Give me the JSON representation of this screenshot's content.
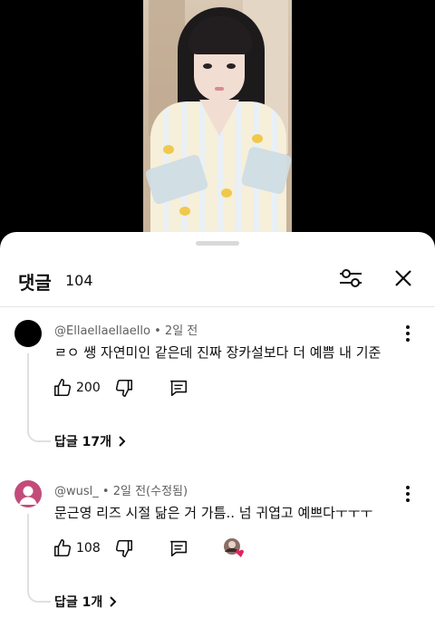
{
  "comments_header": {
    "title": "댓글",
    "count": "104"
  },
  "icons": {
    "filter": "filter-sliders-icon",
    "close": "close-icon",
    "like": "thumb-up-icon",
    "dislike": "thumb-down-icon",
    "reply": "reply-comment-icon",
    "more": "more-vert-icon",
    "expand": "chevron-right-icon"
  },
  "comments": [
    {
      "author": "@Ellaellaellaello",
      "time": "2일 전",
      "text": "ㄹㅇ 쌩 자연미인 같은데 진짜 장카설보다 더 예쁨 내 기준",
      "likes": "200",
      "replies": "답글 17개"
    },
    {
      "author": "@wusl_",
      "time": "2일 전(수정됨)",
      "text": "문근영 리즈 시절 닮은 거 가틈.. 넘 귀엽고 예쁘다ㅜㅜㅜ",
      "likes": "108",
      "replies": "답글 1개"
    }
  ],
  "colors": {
    "accent_heart": "#e0245e",
    "avatar_pink": "#c24b7a",
    "text_primary": "#0f0f0f",
    "text_secondary": "#606060"
  }
}
